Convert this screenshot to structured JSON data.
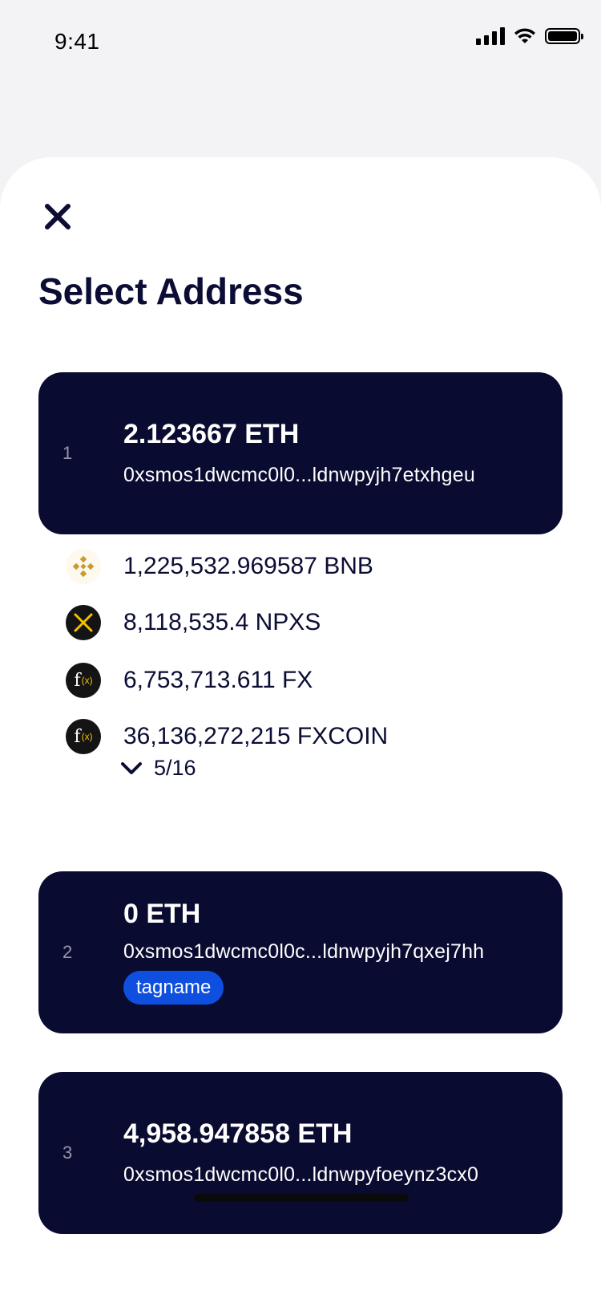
{
  "status_bar": {
    "time": "9:41"
  },
  "sheet": {
    "title": "Select Address"
  },
  "addresses": [
    {
      "index": "1",
      "amount": "2.123667 ETH",
      "address": "0xsmos1dwcmc0l0...ldnwpyjh7etxhgeu",
      "tokens": [
        {
          "amount": "1,225,532.969587 BNB",
          "icon": "bnb-icon"
        },
        {
          "amount": "8,118,535.4 NPXS",
          "icon": "npxs-icon"
        },
        {
          "amount": "6,753,713.611 FX",
          "icon": "fx-icon"
        },
        {
          "amount": "36,136,272,215 FXCOIN",
          "icon": "fxcoin-icon"
        }
      ],
      "expand_label": "5/16"
    },
    {
      "index": "2",
      "amount": "0 ETH",
      "address": "0xsmos1dwcmc0l0c...ldnwpyjh7qxej7hh",
      "tag": "tagname"
    },
    {
      "index": "3",
      "amount": "4,958.947858 ETH",
      "address": "0xsmos1dwcmc0l0...ldnwpyfoeynz3cx0"
    }
  ],
  "colors": {
    "card_background": "#0a0b31",
    "tag_background": "#0f4fe0",
    "title_text": "#0b0d35",
    "bnb_gold": "#c99a2e",
    "npxs_yellow": "#f5c000"
  }
}
